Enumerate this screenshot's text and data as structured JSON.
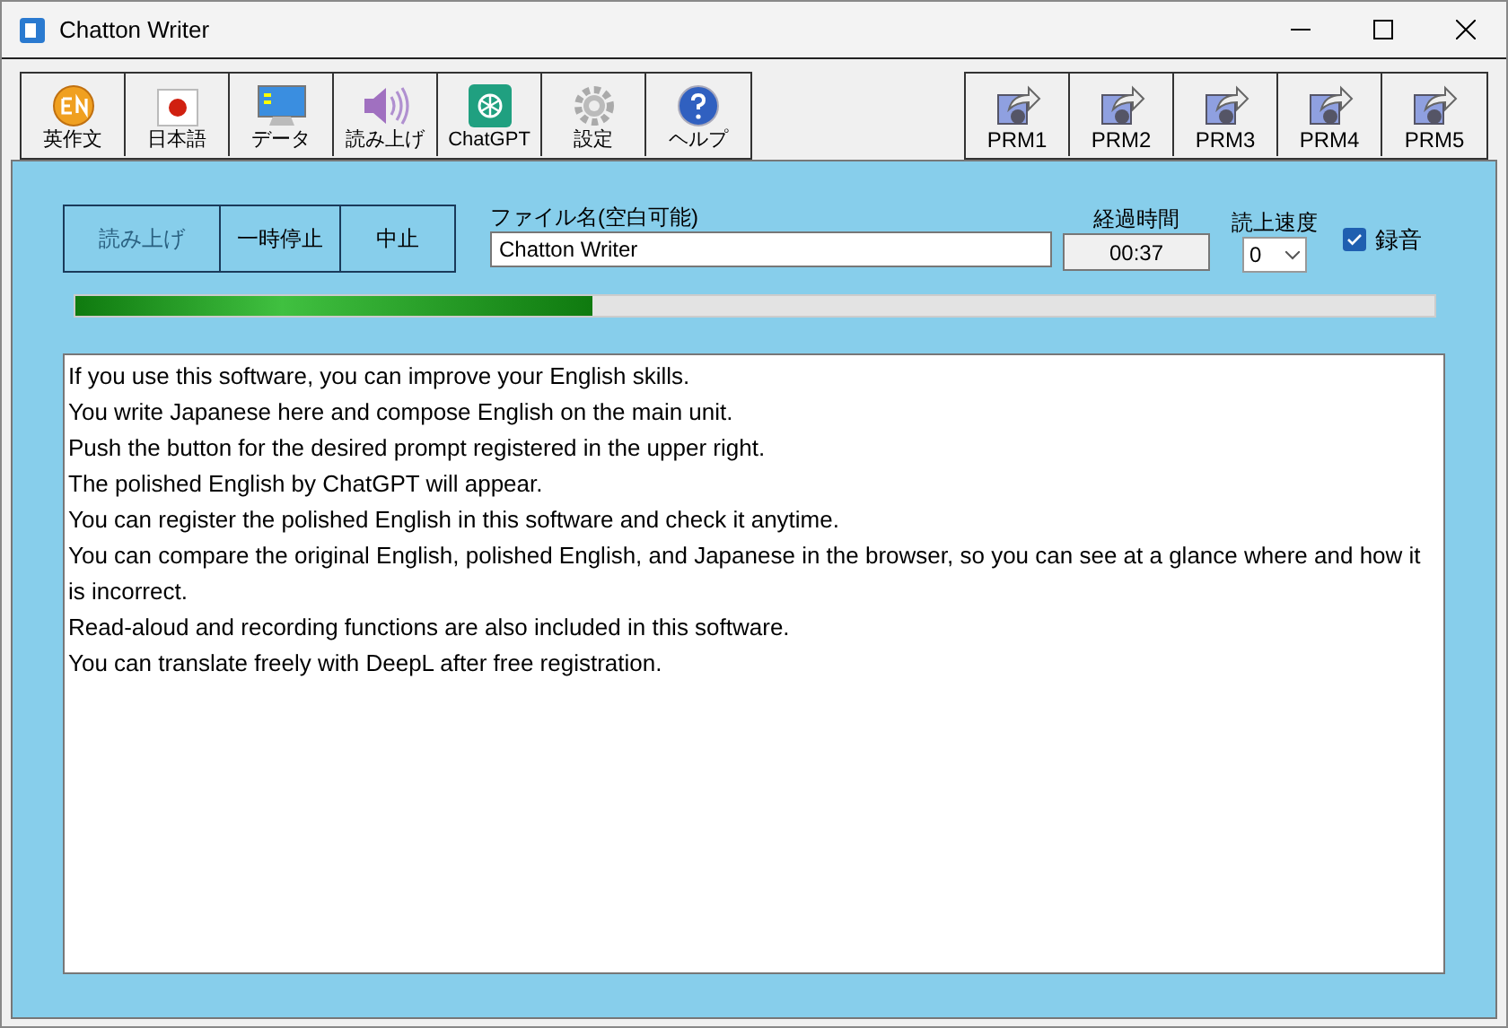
{
  "window": {
    "title": "Chatton Writer"
  },
  "toolbar": [
    {
      "kind": "en",
      "label": "英作文"
    },
    {
      "kind": "flag",
      "label": "日本語"
    },
    {
      "kind": "monitor",
      "label": "データ"
    },
    {
      "kind": "speaker",
      "label": "読み上げ"
    },
    {
      "kind": "chatgpt",
      "label": "ChatGPT"
    },
    {
      "kind": "gear",
      "label": "設定"
    },
    {
      "kind": "help",
      "label": "ヘルプ"
    }
  ],
  "prompts": [
    "PRM1",
    "PRM2",
    "PRM3",
    "PRM4",
    "PRM5"
  ],
  "playback": [
    {
      "label": "読み上げ",
      "disabled": true
    },
    {
      "label": "一時停止",
      "disabled": false
    },
    {
      "label": "中止",
      "disabled": false
    }
  ],
  "file_name": {
    "label": "ファイル名(空白可能)",
    "value": "Chatton Writer"
  },
  "elapsed": {
    "label": "経過時間",
    "value": "00:37"
  },
  "speed": {
    "label": "読上速度",
    "value": "0"
  },
  "record": {
    "label": "録音",
    "checked": true
  },
  "progress": {
    "level": 0.38
  },
  "editor": {
    "lines": [
      "If you use this software, you can improve your English skills.",
      "You write Japanese here and compose English on the main unit.",
      "Push the button for the desired prompt registered in the upper right.",
      "The polished English by ChatGPT will appear.",
      "You can register the polished English in this software and check it anytime.",
      "You can compare the original English, polished English, and Japanese in the browser, so you can see at a glance where and how it is incorrect.",
      "Read-aloud and recording functions are also included in this software.",
      "You can translate freely with DeepL after free registration."
    ]
  }
}
